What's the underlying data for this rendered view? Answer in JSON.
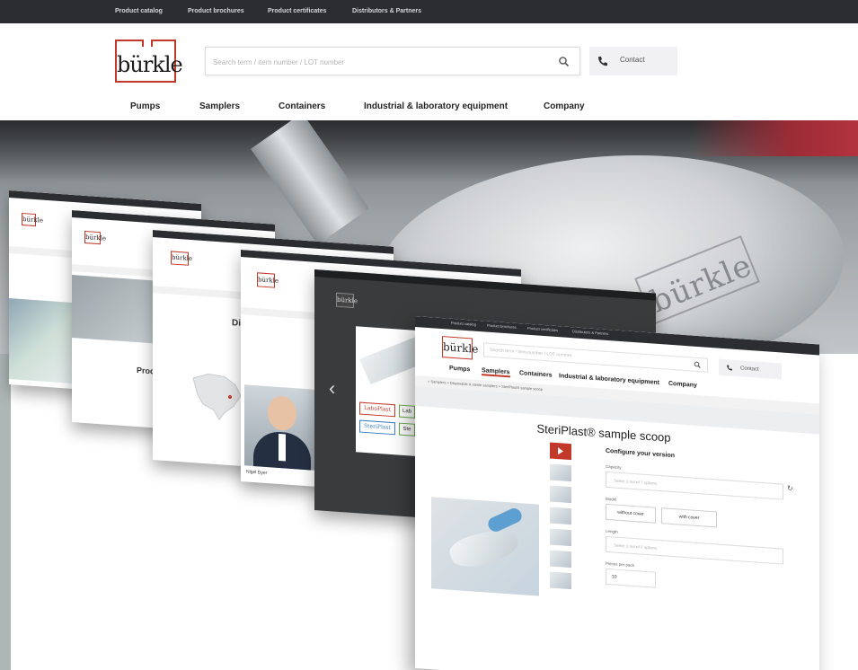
{
  "topbar": {
    "links": [
      "Product catalog",
      "Product brochures",
      "Product certificates",
      "Distributors & Partners"
    ]
  },
  "header": {
    "logo_text": "bürkle",
    "search_placeholder": "Search term / item number / LOT number",
    "contact_label": "Contact"
  },
  "nav": {
    "items": [
      "Pumps",
      "Samplers",
      "Containers",
      "Industrial & laboratory equipment",
      "Company"
    ]
  },
  "hero": {
    "brand_text": "bürkle"
  },
  "cards": {
    "logo_text": "bürkle",
    "card2_heading": "Product",
    "card3_heading": "Dist",
    "card4_person_name": "Nigel Dyer",
    "card5_brand_labels": [
      "LaboPlast",
      "SteriPlast",
      "Lab",
      "Ste"
    ]
  },
  "front": {
    "topbar_links": [
      "Product catalog",
      "Product brochures",
      "Product certificates",
      "Distributors & Partners"
    ],
    "logo_text": "bürkle",
    "search_placeholder": "Search term / item number / LOT number",
    "contact_label": "Contact",
    "nav": [
      "Pumps",
      "Samplers",
      "Containers",
      "Industrial & laboratory equipment",
      "Company"
    ],
    "breadcrumb": "> Samplers > Disposable & sterile samplers > SteriPlast® sample scoop",
    "title": "SteriPlast® sample scoop",
    "configure": {
      "heading": "Configure your version",
      "capacity_label": "Capacity",
      "capacity_placeholder": "Select 1 out of 7 options",
      "model_label": "Model",
      "model_options": [
        "without cover",
        "with cover"
      ],
      "length_label": "Length",
      "length_placeholder": "Select 1 out of 2 options",
      "pieces_label": "Pieces per pack",
      "pieces_value": "10"
    }
  },
  "colors": {
    "brand_red": "#c0392b",
    "topbar": "#2b2d31",
    "contact_bg": "#f1f1f3"
  }
}
